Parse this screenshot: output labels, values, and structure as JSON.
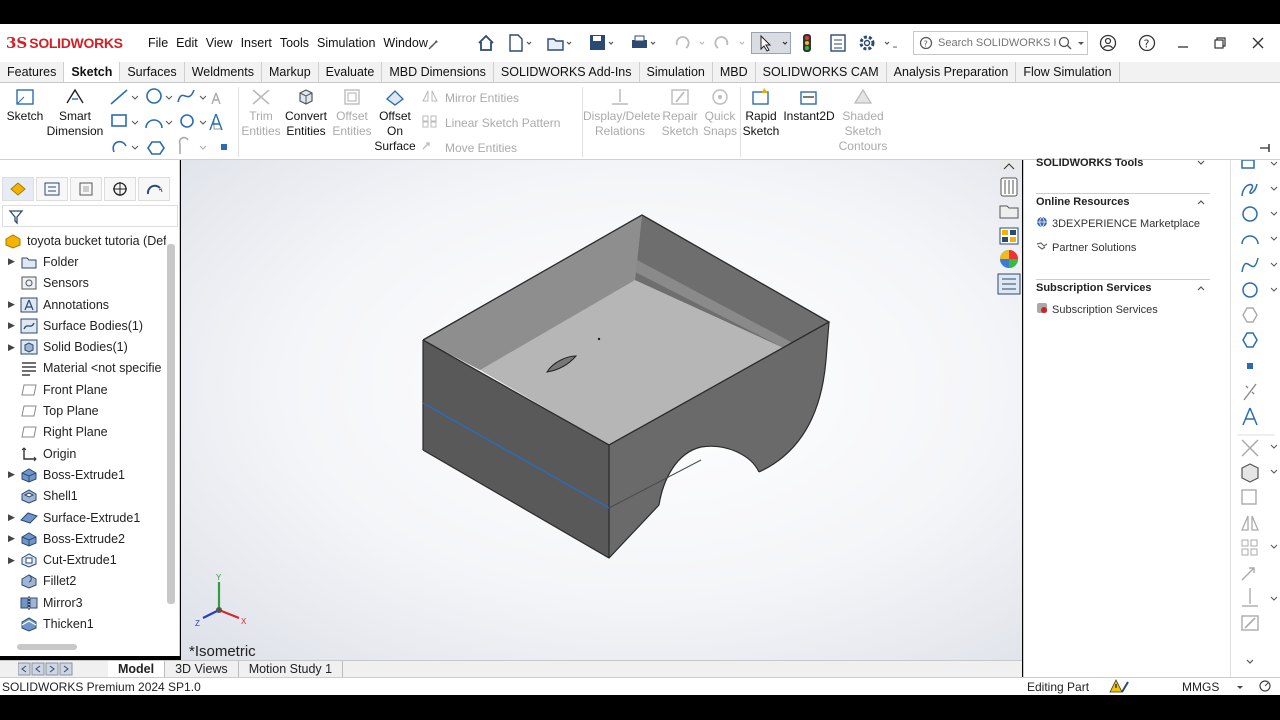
{
  "app": {
    "brand": "SOLIDWORKS",
    "brand_mark": "3S"
  },
  "menus": [
    "File",
    "Edit",
    "View",
    "Insert",
    "Tools",
    "Simulation",
    "Window"
  ],
  "search": {
    "placeholder": "Search SOLIDWORKS H"
  },
  "tabs": [
    "Features",
    "Sketch",
    "Surfaces",
    "Weldments",
    "Markup",
    "Evaluate",
    "MBD Dimensions",
    "SOLIDWORKS Add-Ins",
    "Simulation",
    "MBD",
    "SOLIDWORKS CAM",
    "Analysis Preparation",
    "Flow Simulation"
  ],
  "active_tab": "Sketch",
  "ribbon": {
    "sketch": "Sketch",
    "smart_dim_1": "Smart",
    "smart_dim_2": "Dimension",
    "trim_1": "Trim",
    "trim_2": "Entities",
    "convert_1": "Convert",
    "convert_2": "Entities",
    "offset_1": "Offset",
    "offset_2": "Entities",
    "offset_surf_1": "Offset",
    "offset_surf_2": "On",
    "offset_surf_3": "Surface",
    "mirror": "Mirror Entities",
    "linear_pattern": "Linear Sketch Pattern",
    "move": "Move Entities",
    "display_del_1": "Display/Delete",
    "display_del_2": "Relations",
    "repair_1": "Repair",
    "repair_2": "Sketch",
    "quick_1": "Quick",
    "quick_2": "Snaps",
    "rapid_1": "Rapid",
    "rapid_2": "Sketch",
    "instant2d": "Instant2D",
    "shaded_1": "Shaded",
    "shaded_2": "Sketch",
    "shaded_3": "Contours"
  },
  "tree": {
    "root": "toyota bucket tutoria (Def",
    "items": [
      {
        "label": "Folder",
        "icon": "folder-icon",
        "arrow": true
      },
      {
        "label": "Sensors",
        "icon": "sensor-icon",
        "arrow": false
      },
      {
        "label": "Annotations",
        "icon": "annotation-icon",
        "arrow": true
      },
      {
        "label": "Surface Bodies(1)",
        "icon": "surface-bodies-icon",
        "arrow": true
      },
      {
        "label": "Solid Bodies(1)",
        "icon": "solid-bodies-icon",
        "arrow": true
      },
      {
        "label": "Material <not specifie",
        "icon": "material-icon",
        "arrow": false
      },
      {
        "label": "Front Plane",
        "icon": "plane-icon",
        "arrow": false
      },
      {
        "label": "Top Plane",
        "icon": "plane-icon",
        "arrow": false
      },
      {
        "label": "Right Plane",
        "icon": "plane-icon",
        "arrow": false
      },
      {
        "label": "Origin",
        "icon": "origin-icon",
        "arrow": false
      },
      {
        "label": "Boss-Extrude1",
        "icon": "extrude-icon",
        "arrow": true
      },
      {
        "label": "Shell1",
        "icon": "shell-icon",
        "arrow": false
      },
      {
        "label": "Surface-Extrude1",
        "icon": "surface-extrude-icon",
        "arrow": true
      },
      {
        "label": "Boss-Extrude2",
        "icon": "extrude-icon",
        "arrow": true
      },
      {
        "label": "Cut-Extrude1",
        "icon": "cut-extrude-icon",
        "arrow": true
      },
      {
        "label": "Fillet2",
        "icon": "fillet-icon",
        "arrow": false
      },
      {
        "label": "Mirror3",
        "icon": "mirror-icon",
        "arrow": false
      },
      {
        "label": "Thicken1",
        "icon": "thicken-icon",
        "arrow": false
      }
    ]
  },
  "viewport": {
    "view_name": "*Isometric",
    "triad": {
      "x": "X",
      "y": "Y",
      "z": "Z"
    }
  },
  "taskpane": {
    "tools_header": "SOLIDWORKS Tools",
    "online_header": "Online Resources",
    "marketplace": "3DEXPERIENCE Marketplace",
    "partner": "Partner Solutions",
    "subscription_header": "Subscription Services",
    "subscription": "Subscription Services"
  },
  "bottom_tabs": [
    "Model",
    "3D Views",
    "Motion Study 1"
  ],
  "status": {
    "version": "SOLIDWORKS Premium 2024 SP1.0",
    "mode": "Editing Part",
    "units": "MMGS"
  },
  "colors": {
    "brand": "#d41f26",
    "accent": "#2b4a72",
    "edge_blue": "#1f6fd0"
  }
}
